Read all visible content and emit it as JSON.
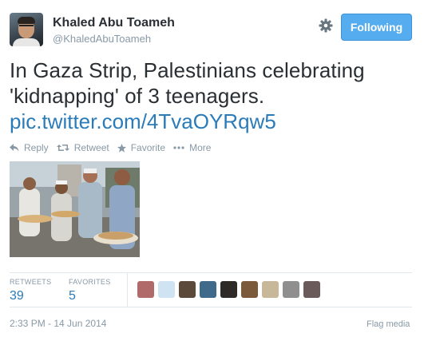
{
  "user": {
    "name": "Khaled Abu Toameh",
    "handle": "@KhaledAbuToameh"
  },
  "follow_button": {
    "label": "Following",
    "color": "#55acee"
  },
  "tweet": {
    "text": "In Gaza Strip, Palestinians celebrating 'kidnapping' of 3 teenagers.",
    "link": "pic.twitter.com/4TvaOYRqw5"
  },
  "actions": [
    {
      "label": "Reply",
      "icon": "reply-icon"
    },
    {
      "label": "Retweet",
      "icon": "retweet-icon"
    },
    {
      "label": "Favorite",
      "icon": "star-icon"
    },
    {
      "label": "More",
      "icon": "ellipsis-icon"
    }
  ],
  "stats": {
    "retweets_label": "RETWEETS",
    "retweets": "39",
    "favorites_label": "FAVORITES",
    "favorites": "5"
  },
  "favoriter_avatar_colors": [
    "#b06a6a",
    "#cfe3f2",
    "#5b4a3a",
    "#3f6a8a",
    "#2e2a28",
    "#7a5a3a",
    "#c8b89a",
    "#8f8f8f",
    "#6b5a5a"
  ],
  "footer": {
    "timestamp": "2:33 PM - 14 Jun 2014",
    "flag_label": "Flag media"
  },
  "colors": {
    "accent": "#55acee",
    "link": "#2b7bb9",
    "muted": "#8899a6"
  }
}
